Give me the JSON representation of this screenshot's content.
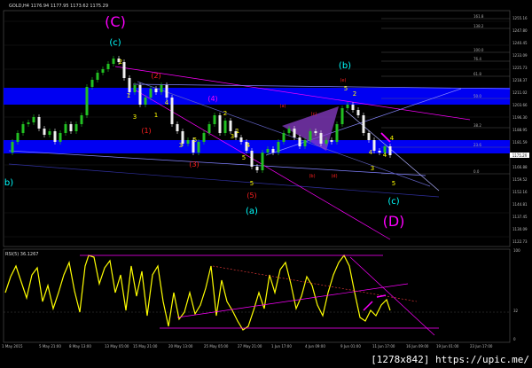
{
  "window": {
    "title": "GOLD,H4  1176.94 1177.95 1173.62 1175.29",
    "indicator_title": "RSI(5) 36.1267",
    "watermark": "[1278x842] https://upic.me/"
  },
  "colors": {
    "background": "#000000",
    "grid": "#1c1c1c",
    "price_line": "#e0e0e0",
    "bull_candle": "#22c022",
    "bear_candle": "#f0f0f0",
    "zone": "#0000ff",
    "rsi": "#ffff00",
    "magenta": "#ff00ff",
    "cyan": "#00ffff",
    "red": "#ff2020",
    "yellow": "#ffff00",
    "orange": "#ffa500",
    "purple_triangle": "#8a3cc8",
    "navy_line": "#3030a0"
  },
  "price_axis": {
    "labels": [
      "1255.16",
      "1247.80",
      "1240.45",
      "1233.09",
      "1225.73",
      "1218.37",
      "1211.02",
      "1203.66",
      "1196.30",
      "1188.95",
      "1181.59",
      "1174.23",
      "1166.88",
      "1159.52",
      "1152.16",
      "1144.81",
      "1137.45",
      "1130.09",
      "1122.73"
    ],
    "current": "1175.29"
  },
  "rsi_axis": {
    "labels": [
      "100",
      "32",
      "0"
    ]
  },
  "time_axis": {
    "labels": [
      "1 May 2015",
      "5 May 21:00",
      "8 May 13:00",
      "13 May 05:00",
      "15 May 21:00",
      "20 May 13:00",
      "25 May 05:00",
      "27 May 21:00",
      "1 Jun 17:00",
      "4 Jun 09:00",
      "9 Jun 01:00",
      "11 Jun 17:00",
      "16 Jun 09:00",
      "19 Jun 01:00",
      "23 Jun 17:00"
    ]
  },
  "fib_levels": [
    "161.8",
    "138.2",
    "100.0",
    "76.4",
    "61.8",
    "50.0",
    "38.2",
    "23.6",
    "0.0"
  ],
  "wave_labels": {
    "big_C": "(C)",
    "big_D": "(D)",
    "c": "(c)",
    "a": "(a)",
    "b": "(b)",
    "c2": "(c)",
    "b_left": "b)",
    "red_2": "(2)",
    "red_1": "(1)",
    "red_3": "(3)",
    "red_4": "(4)",
    "red_5": "(5)",
    "y1": "1",
    "y2": "2",
    "y3": "3",
    "y4": "4",
    "y5": "5",
    "o_a": "(a)",
    "o_b": "(b)",
    "o_c": "(c)",
    "o_d": "(d)",
    "o_e": "(e)"
  }
}
